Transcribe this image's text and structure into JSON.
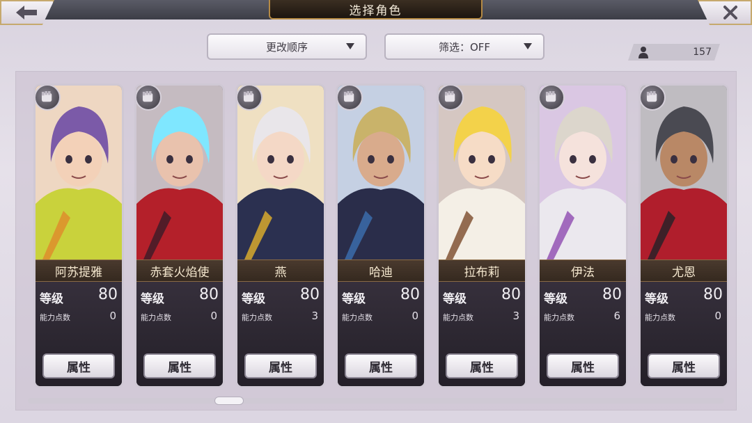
{
  "header": {
    "title": "选择角色",
    "back_icon": "arrow-left-icon",
    "close_icon": "close-icon"
  },
  "toolbar": {
    "sort_label": "更改顺序",
    "filter_label": "筛选：OFF",
    "count": "157"
  },
  "labels": {
    "level": "等级",
    "ability_points": "能力点数",
    "attributes": "属性"
  },
  "characters": [
    {
      "name": "阿苏提雅",
      "level": "80",
      "points": "0",
      "hair": "#7b5aa8",
      "skin": "#f3d1b8",
      "outfit": "#c9d23c",
      "accent": "#e08a2a"
    },
    {
      "name": "赤套火焰使",
      "level": "80",
      "points": "0",
      "hair": "#7fe7ff",
      "skin": "#e9c2ad",
      "outfit": "#b4202a",
      "accent": "#3a1c28"
    },
    {
      "name": "燕",
      "level": "80",
      "points": "3",
      "hair": "#e9e6ea",
      "skin": "#f4d8c6",
      "outfit": "#2b3050",
      "accent": "#e2b12a"
    },
    {
      "name": "哈迪",
      "level": "80",
      "points": "0",
      "hair": "#c9b36a",
      "skin": "#d9ab8c",
      "outfit": "#2a2d4a",
      "accent": "#3c6fb0"
    },
    {
      "name": "拉布莉",
      "level": "80",
      "points": "3",
      "hair": "#f3d24a",
      "skin": "#f6dcc6",
      "outfit": "#f4efe6",
      "accent": "#7a4a2a"
    },
    {
      "name": "伊法",
      "level": "80",
      "points": "6",
      "hair": "#dcd6cc",
      "skin": "#f5e2dc",
      "outfit": "#ebe8ee",
      "accent": "#8e4ab0"
    },
    {
      "name": "尤恩",
      "level": "80",
      "points": "0",
      "hair": "#4a4a52",
      "skin": "#b98866",
      "outfit": "#b01e2c",
      "accent": "#222028"
    }
  ]
}
